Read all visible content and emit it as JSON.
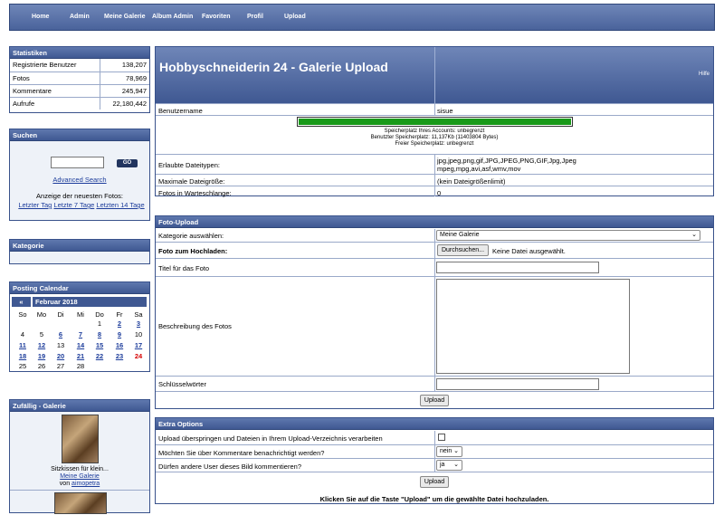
{
  "nav": [
    "Home",
    "Admin",
    "Meine Galerie",
    "Album Admin",
    "Favoriten",
    "Profil",
    "Upload"
  ],
  "stats": {
    "title": "Statistiken",
    "rows": [
      {
        "label": "Registrierte Benutzer",
        "value": "138,207"
      },
      {
        "label": "Fotos",
        "value": "78,969"
      },
      {
        "label": "Kommentare",
        "value": "245,947"
      },
      {
        "label": "Aufrufe",
        "value": "22,180,442"
      }
    ]
  },
  "search": {
    "title": "Suchen",
    "go": "GO",
    "advanced": "Advanced Search",
    "newest": "Anzeige der neuesten Fotos:",
    "link1": "Letzter Tag",
    "link2": "Letzte 7 Tage",
    "link3": "Letzten 14 Tage"
  },
  "kategorie": {
    "title": "Kategorie"
  },
  "calendar": {
    "title": "Posting Calendar",
    "prev": "«",
    "month": "Februar 2018",
    "weekdays": [
      "So",
      "Mo",
      "Di",
      "Mi",
      "Do",
      "Fr",
      "Sa"
    ],
    "d1": "1",
    "d2": "2",
    "d3": "3",
    "d4": "4",
    "d5": "5",
    "d6": "6",
    "d7": "7",
    "d8": "8",
    "d9": "9",
    "d10": "10",
    "d11": "11",
    "d12": "12",
    "d13": "13",
    "d14": "14",
    "d15": "15",
    "d16": "16",
    "d17": "17",
    "d18": "18",
    "d19": "19",
    "d20": "20",
    "d21": "21",
    "d22": "22",
    "d23": "23",
    "d24": "24",
    "d25": "25",
    "d26": "26",
    "d27": "27",
    "d28": "28"
  },
  "zufall": {
    "title": "Zufällig - Galerie",
    "caption": "Sitzkissen für klein...",
    "album": "Meine Galerie",
    "von": "von",
    "user": "aimopetra"
  },
  "upload": {
    "title": "Hobbyschneiderin 24 - Galerie Upload",
    "hilfe": "Hilfe",
    "username_label": "Benutzername",
    "username": "sisue",
    "quota1": "Speicherplatz Ihres Accounts: unbegrenzt",
    "quota2": "Benutzter Speicherplatz: 11,137Kb (11403804 Bytes)",
    "quota3": "Freier Speicherplatz: unbegrenzt",
    "types_label": "Erlaubte Dateitypen:",
    "types": "jpg,jpeg,png,gif,JPG,JPEG,PNG,GIF,Jpg,Jpeg mpeg,mpg,avi,asf,wmv,mov",
    "maxsize_label": "Maximale Dateigröße:",
    "maxsize": "(kein Dateigrößenlimit)",
    "queue_label": "Fotos in Warteschlange:",
    "queue": "0"
  },
  "fotoupload": {
    "title": "Foto-Upload",
    "cat_label": "Kategorie auswählen:",
    "cat_value": "Meine Galerie",
    "file_label": "Foto zum Hochladen:",
    "browse": "Durchsuchen...",
    "nofile": "Keine Datei ausgewählt.",
    "phototitle_label": "Titel für das Foto",
    "desc_label": "Beschreibung des Fotos",
    "keywords_label": "Schlüsselwörter",
    "upload_btn": "Upload"
  },
  "extra": {
    "title": "Extra Options",
    "opt1": "Upload überspringen und Dateien in Ihrem Upload-Verzeichnis verarbeiten",
    "opt2": "Möchten Sie über Kommentare benachrichtigt werden?",
    "opt2_value": "nein",
    "opt3": "Dürfen andere User dieses Bild kommentieren?",
    "opt3_value": "ja",
    "upload_btn": "Upload",
    "hint": "Klicken Sie auf die Taste \"Upload\" um die gewählte Datei hochzuladen."
  }
}
